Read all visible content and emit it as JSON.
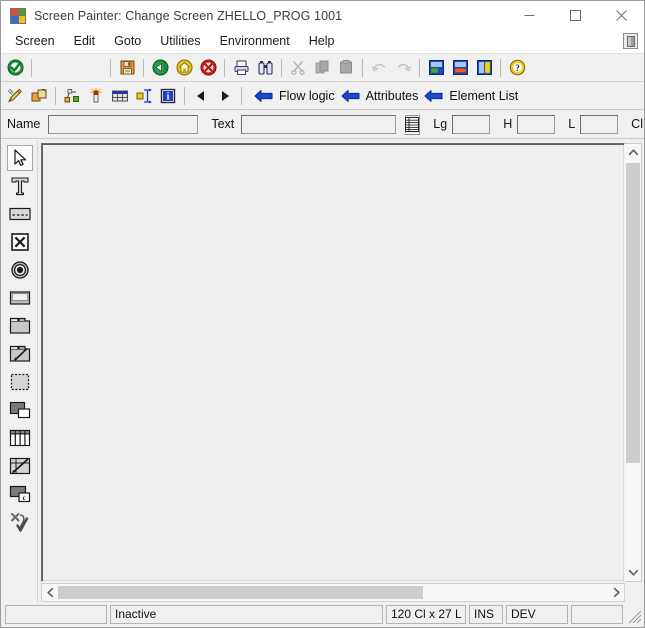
{
  "window": {
    "app_icon": "sap-logo-icon",
    "title": "Screen Painter:  Change Screen ZHELLO_PROG 1001",
    "minimize_label": "minimize-icon",
    "maximize_label": "maximize-icon",
    "close_label": "close-icon"
  },
  "menubar": {
    "items": [
      {
        "label": "Screen"
      },
      {
        "label": "Edit"
      },
      {
        "label": "Goto"
      },
      {
        "label": "Utilities"
      },
      {
        "label": "Environment"
      },
      {
        "label": "Help"
      }
    ],
    "right_icon": "layout-panel-icon"
  },
  "toolbar_primary": {
    "buttons": [
      {
        "name": "check-enter-button",
        "icon": "green-check-circle-icon"
      },
      {
        "name": "save-button",
        "icon": "floppy-save-icon"
      },
      {
        "name": "back-button",
        "icon": "green-back-arrow-icon"
      },
      {
        "name": "exit-button",
        "icon": "yellow-exit-icon"
      },
      {
        "name": "cancel-button",
        "icon": "red-cancel-icon"
      },
      {
        "name": "print-button",
        "icon": "printer-icon"
      },
      {
        "name": "find-button",
        "icon": "binoculars-find-icon"
      },
      {
        "name": "cut-button",
        "icon": "scissors-cut-icon"
      },
      {
        "name": "copy-button",
        "icon": "copy-pages-icon"
      },
      {
        "name": "paste-button",
        "icon": "paste-clipboard-icon"
      },
      {
        "name": "undo-button",
        "icon": "undo-arrow-icon"
      },
      {
        "name": "redo-button",
        "icon": "redo-arrow-icon"
      },
      {
        "name": "layout-editor-button",
        "icon": "screen-layout-green-icon"
      },
      {
        "name": "flow-logic-button",
        "icon": "screen-layout-orange-icon"
      },
      {
        "name": "element-list-button",
        "icon": "screen-layout-yellow-icon"
      },
      {
        "name": "help-button",
        "icon": "question-help-icon"
      }
    ]
  },
  "toolbar_secondary": {
    "buttons": [
      {
        "name": "graphical-editor-button",
        "icon": "pencil-ruler-icon"
      },
      {
        "name": "copy-screen-button",
        "icon": "copy-screen-icon"
      },
      {
        "name": "align-button",
        "icon": "align-elements-icon"
      },
      {
        "name": "highlight-button",
        "icon": "highlight-sparkle-icon"
      },
      {
        "name": "table-control-button",
        "icon": "table-control-icon"
      },
      {
        "name": "resize-button",
        "icon": "resize-arrows-icon"
      },
      {
        "name": "info-button",
        "icon": "blue-info-icon"
      },
      {
        "name": "previous-screen-button",
        "icon": "triangle-left-icon"
      },
      {
        "name": "next-screen-button",
        "icon": "triangle-right-icon"
      }
    ],
    "nav_buttons": [
      {
        "name": "flow-logic-nav",
        "label": "Flow logic",
        "icon": "blue-left-arrow-icon"
      },
      {
        "name": "attributes-nav",
        "label": "Attributes",
        "icon": "blue-left-arrow-icon"
      },
      {
        "name": "element-list-nav",
        "label": "Element List",
        "icon": "blue-left-arrow-icon"
      }
    ]
  },
  "field_row": {
    "name_label": "Name",
    "name_value": "",
    "name_placeholder": "",
    "text_label": "Text",
    "text_value": "",
    "text_placeholder": "",
    "dict_button_icon": "dictionary-fields-icon",
    "lg_label": "Lg",
    "lg_value": "",
    "h_label": "H",
    "h_value": "",
    "l_label": "L",
    "l_value": "",
    "cl_label": "Cl",
    "cl_value": ""
  },
  "palette": {
    "tools": [
      {
        "name": "pointer-tool",
        "icon": "arrow-pointer-icon",
        "selected": true
      },
      {
        "name": "text-field-tool",
        "icon": "text-t-icon",
        "selected": false
      },
      {
        "name": "input-output-field-tool",
        "icon": "input-field-icon",
        "selected": false
      },
      {
        "name": "checkbox-tool",
        "icon": "checkbox-x-icon",
        "selected": false
      },
      {
        "name": "radio-button-tool",
        "icon": "radio-button-icon",
        "selected": false
      },
      {
        "name": "pushbutton-tool",
        "icon": "pushbutton-icon",
        "selected": false
      },
      {
        "name": "tabstrip-tool",
        "icon": "tabstrip-icon",
        "selected": false
      },
      {
        "name": "tabstrip-wizard-tool",
        "icon": "tabstrip-wizard-icon",
        "selected": false
      },
      {
        "name": "subscreen-tool",
        "icon": "subscreen-dotted-icon",
        "selected": false
      },
      {
        "name": "box-frame-tool",
        "icon": "box-frame-icon",
        "selected": false
      },
      {
        "name": "table-control-tool",
        "icon": "table-control-grid-icon",
        "selected": false
      },
      {
        "name": "table-control-wizard-tool",
        "icon": "table-wizard-icon",
        "selected": false
      },
      {
        "name": "custom-control-tool",
        "icon": "custom-control-icon",
        "selected": false
      },
      {
        "name": "status-icon-tool",
        "icon": "status-check-icon",
        "selected": false
      }
    ]
  },
  "canvas": {
    "name": "screen-layout-canvas",
    "content": ""
  },
  "scrollbars": {
    "vertical_up": "scroll-up-arrow-icon",
    "vertical_down": "scroll-down-arrow-icon",
    "horizontal_left": "scroll-left-arrow-icon",
    "horizontal_right": "scroll-right-arrow-icon"
  },
  "statusbar": {
    "message_area": "",
    "status_text": "Inactive",
    "dimensions": "120 Cl x 27 L",
    "insert_mode": "INS",
    "system": "DEV",
    "extra": "",
    "grip_icon": "resize-grip-icon"
  }
}
